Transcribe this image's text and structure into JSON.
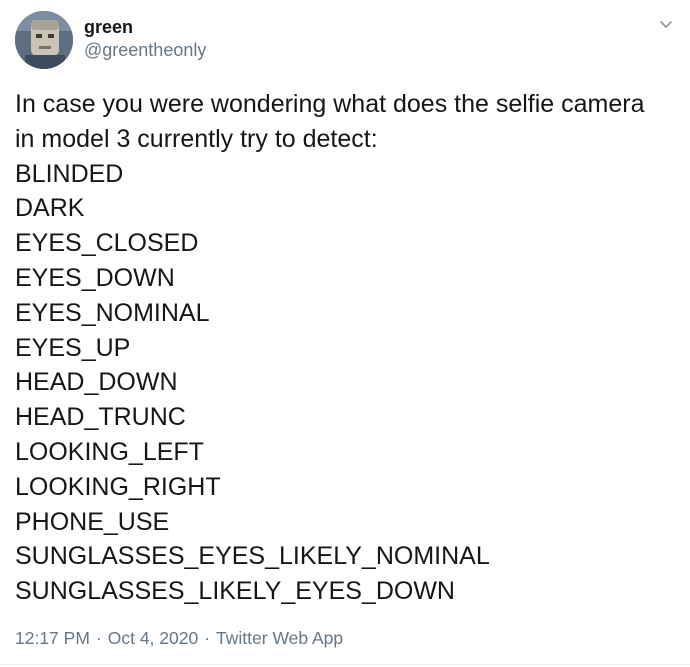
{
  "author": {
    "display_name": "green",
    "handle": "@greentheonly",
    "avatar_icon": "avatar-robot-face-icon"
  },
  "menu_icon": "chevron-down-icon",
  "tweet": {
    "lines": [
      "In case you were wondering what does the selfie camera",
      "in model 3 currently try to detect:",
      "BLINDED",
      "DARK",
      "EYES_CLOSED",
      "EYES_DOWN",
      "EYES_NOMINAL",
      "EYES_UP",
      "HEAD_DOWN",
      "HEAD_TRUNC",
      "LOOKING_LEFT",
      "LOOKING_RIGHT",
      "PHONE_USE",
      "SUNGLASSES_EYES_LIKELY_NOMINAL",
      "SUNGLASSES_LIKELY_EYES_DOWN"
    ]
  },
  "meta": {
    "time": "12:17 PM",
    "separator": "·",
    "date": "Oct 4, 2020",
    "source": "Twitter Web App"
  },
  "colors": {
    "text": "#14171a",
    "secondary": "#657786",
    "divider": "#e6ecf0"
  }
}
